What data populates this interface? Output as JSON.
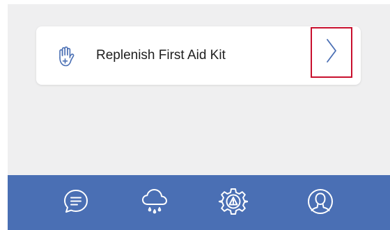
{
  "task_card": {
    "label": "Replenish First Aid Kit",
    "icon": "first-aid-hand-icon",
    "action_icon": "chevron-right-icon"
  },
  "tab_bar": {
    "items": [
      {
        "icon": "chat-bubble-icon"
      },
      {
        "icon": "rain-cloud-icon"
      },
      {
        "icon": "hazard-gear-icon"
      },
      {
        "icon": "user-profile-icon"
      }
    ]
  },
  "colors": {
    "accent": "#4a6fb4",
    "icon_blue": "#4a6fb4",
    "highlight": "#c8102e",
    "background": "#efeff0",
    "card": "#ffffff",
    "text": "#1e1e1e"
  }
}
